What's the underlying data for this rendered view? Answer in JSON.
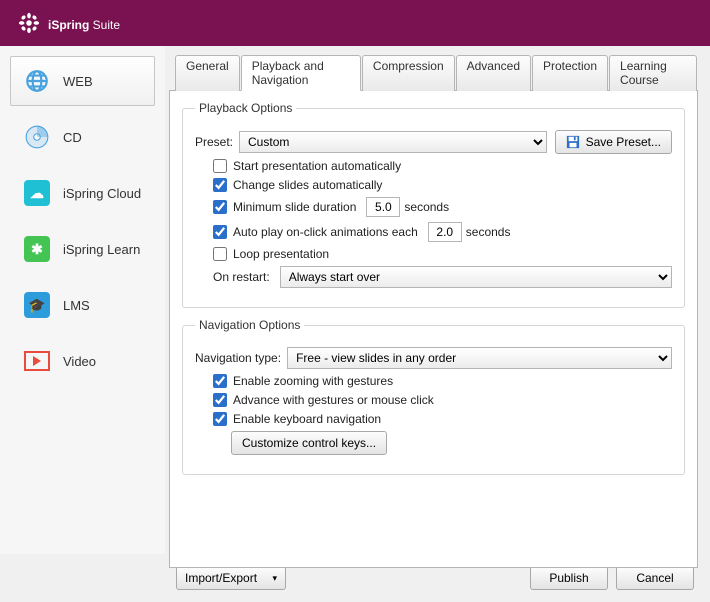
{
  "app": {
    "brand_bold": "iSpring",
    "brand_light": " Suite"
  },
  "sidebar": {
    "items": [
      {
        "label": "WEB"
      },
      {
        "label": "CD"
      },
      {
        "label": "iSpring Cloud"
      },
      {
        "label": "iSpring Learn"
      },
      {
        "label": "LMS"
      },
      {
        "label": "Video"
      }
    ]
  },
  "tabs": [
    "General",
    "Playback and Navigation",
    "Compression",
    "Advanced",
    "Protection",
    "Learning Course"
  ],
  "playback": {
    "legend": "Playback Options",
    "preset_label": "Preset:",
    "preset_value": "Custom",
    "save_preset": "Save Preset...",
    "opt_start": "Start presentation automatically",
    "opt_change": "Change slides automatically",
    "opt_min_dur": "Minimum slide duration",
    "opt_min_dur_val": "5.0",
    "seconds": "seconds",
    "opt_autoplay": "Auto play on-click animations each",
    "opt_autoplay_val": "2.0",
    "opt_loop": "Loop presentation",
    "restart_label": "On restart:",
    "restart_value": "Always start over"
  },
  "nav": {
    "legend": "Navigation Options",
    "type_label": "Navigation type:",
    "type_value": "Free - view slides in any order",
    "opt_zoom": "Enable zooming with gestures",
    "opt_advance": "Advance with gestures or mouse click",
    "opt_kbd": "Enable keyboard navigation",
    "customize": "Customize control keys..."
  },
  "footer": {
    "import_export": "Import/Export",
    "publish": "Publish",
    "cancel": "Cancel"
  }
}
